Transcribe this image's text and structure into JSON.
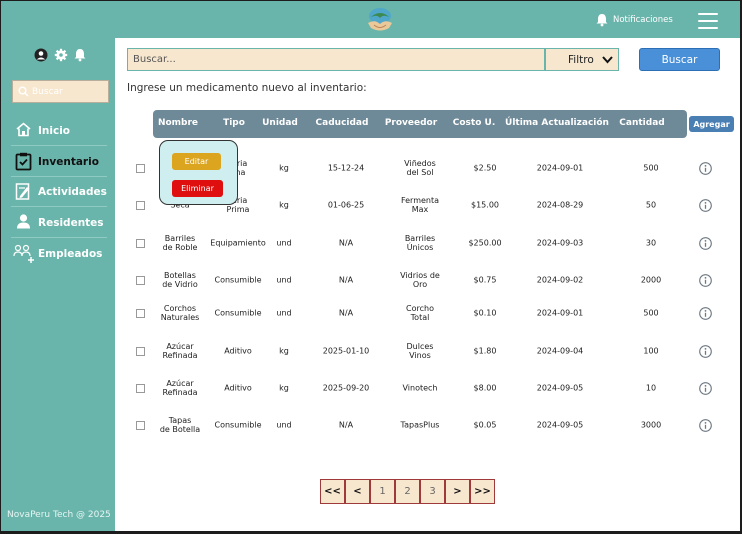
{
  "topbar": {
    "notifications_label": "Notificaciones",
    "icons": [
      "logo-icon",
      "bell-icon",
      "menu-icon"
    ]
  },
  "sidebar": {
    "top_icons": [
      "user-circle-icon",
      "gear-icon",
      "bell-icon"
    ],
    "search_placeholder": "Buscar",
    "items": [
      {
        "label": "Inicio",
        "icon": "home-icon",
        "active": false
      },
      {
        "label": "Inventario",
        "icon": "clipboard-icon",
        "active": true
      },
      {
        "label": "Actividades",
        "icon": "edit-doc-icon",
        "active": false
      },
      {
        "label": "Residentes",
        "icon": "person-icon",
        "active": false
      },
      {
        "label": "Empleados",
        "icon": "group-add-icon",
        "active": false
      }
    ],
    "footer": "NovaPeru Tech @ 2025"
  },
  "main": {
    "search_placeholder": "Buscar...",
    "filter_label": "Filtro",
    "search_button": "Buscar",
    "intro": "Ingrese un medicamento nuevo al inventario:",
    "add_button": "Agregar",
    "columns": [
      "Nombre",
      "Tipo",
      "Unidad",
      "Caducidad",
      "Proveedor",
      "Costo U.",
      "Última Actualización",
      "Cantidad"
    ],
    "rows": [
      {
        "nombre": "",
        "tipo": "teria\nima",
        "unidad": "kg",
        "caducidad": "15-12-24",
        "proveedor": "Viñedos\ndel Sol",
        "costo": "$2.50",
        "actualizacion": "2024-09-01",
        "cantidad": "500"
      },
      {
        "nombre": "Seca",
        "tipo": "teria\nPrima",
        "unidad": "kg",
        "caducidad": "01-06-25",
        "proveedor": "Fermenta\nMax",
        "costo": "$15.00",
        "actualizacion": "2024-08-29",
        "cantidad": "50"
      },
      {
        "nombre": "Barriles\nde Roble",
        "tipo": "Equipamiento",
        "unidad": "und",
        "caducidad": "N/A",
        "proveedor": "Barriles\nÚnicos",
        "costo": "$250.00",
        "actualizacion": "2024-09-03",
        "cantidad": "30"
      },
      {
        "nombre": "Botellas\nde Vidrio",
        "tipo": "Consumible",
        "unidad": "und",
        "caducidad": "N/A",
        "proveedor": "Vidrios de\nOro",
        "costo": "$0.75",
        "actualizacion": "2024-09-02",
        "cantidad": "2000"
      },
      {
        "nombre": "Corchos\nNaturales",
        "tipo": "Consumible",
        "unidad": "und",
        "caducidad": "N/A",
        "proveedor": "Corcho\nTotal",
        "costo": "$0.10",
        "actualizacion": "2024-09-01",
        "cantidad": "500"
      },
      {
        "nombre": "Azúcar\nRefinada",
        "tipo": "Aditivo",
        "unidad": "kg",
        "caducidad": "2025-01-10",
        "proveedor": "Dulces\nVinos",
        "costo": "$1.80",
        "actualizacion": "2024-09-04",
        "cantidad": "100"
      },
      {
        "nombre": "Azúcar\nRefinada",
        "tipo": "Aditivo",
        "unidad": "kg",
        "caducidad": "2025-09-20",
        "proveedor": "Vinotech",
        "costo": "$8.00",
        "actualizacion": "2024-09-05",
        "cantidad": "10"
      },
      {
        "nombre": "Tapas\nde Botella",
        "tipo": "Consumible",
        "unidad": "und",
        "caducidad": "N/A",
        "proveedor": "TapasPlus",
        "costo": "$0.05",
        "actualizacion": "2024-09-05",
        "cantidad": "3000"
      }
    ],
    "context_menu": {
      "edit": "Editar",
      "delete": "Eliminar"
    },
    "pagination": [
      "<<",
      "<",
      "1",
      "2",
      "3",
      ">",
      ">>"
    ]
  },
  "colors": {
    "teal": "#6ab5ab",
    "cream": "#f7e7cf",
    "header_slate": "#6e8997",
    "blue": "#4a90d9",
    "edit": "#dba520",
    "delete": "#e00f0f"
  }
}
